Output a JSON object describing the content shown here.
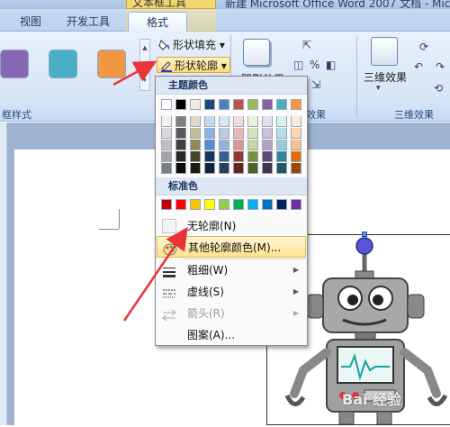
{
  "titlebar": {
    "tool_tab_text": "文本框工具",
    "window_title": "新建 Microsoft Office Word 2007 文档 - Mic"
  },
  "tabs": [
    {
      "label": "视图"
    },
    {
      "label": "开发工具"
    },
    {
      "label": "格式"
    }
  ],
  "ribbon": {
    "group_labels": {
      "box_styles": "框样式",
      "shadow_effects": "效果",
      "threeD_effects": "三维效果"
    },
    "style_swatches": [
      "#8567b4",
      "#4aaec5",
      "#f29644"
    ],
    "shape_fill_label": "形状填充",
    "shape_outline_label": "形状轮廓",
    "shadow_label": "阴影效果",
    "threeD_label": "三维效果"
  },
  "dropdown": {
    "theme_colors_header": "主题颜色",
    "standard_colors_header": "标准色",
    "theme_top_row": [
      "#ffffff",
      "#000000",
      "#eeece1",
      "#1f497d",
      "#4f81bd",
      "#c0504d",
      "#9bbb59",
      "#8064a2",
      "#4bacc6",
      "#f79646"
    ],
    "theme_shades": [
      [
        "#f2f2f2",
        "#7f7f7f",
        "#ddd9c3",
        "#c6d9f0",
        "#dbe5f1",
        "#f2dcdb",
        "#ebf1dd",
        "#e5e0ec",
        "#dbeef3",
        "#fdeada"
      ],
      [
        "#d8d8d8",
        "#595959",
        "#c4bd97",
        "#8db3e2",
        "#b8cce4",
        "#e5b9b7",
        "#d7e3bc",
        "#ccc1d9",
        "#b7dde8",
        "#fbd5b5"
      ],
      [
        "#bfbfbf",
        "#3f3f3f",
        "#938953",
        "#548dd4",
        "#95b3d7",
        "#d99694",
        "#c3d69b",
        "#b2a2c7",
        "#92cddc",
        "#fac08f"
      ],
      [
        "#a5a5a5",
        "#262626",
        "#494429",
        "#17365d",
        "#366092",
        "#953734",
        "#76923c",
        "#5f497a",
        "#31859b",
        "#e36c09"
      ],
      [
        "#7f7f7f",
        "#0c0c0c",
        "#1d1b10",
        "#0f243e",
        "#244061",
        "#632423",
        "#4f6128",
        "#3f3151",
        "#205867",
        "#974806"
      ]
    ],
    "standard_colors": [
      "#c00000",
      "#ff0000",
      "#ffc000",
      "#ffff00",
      "#92d050",
      "#00b050",
      "#00b0f0",
      "#0070c0",
      "#002060",
      "#7030a0"
    ],
    "items": {
      "no_outline": "无轮廓(N)",
      "more_colors": "其他轮廓颜色(M)...",
      "weight": "粗细(W)",
      "dashes": "虚线(S)",
      "arrows": "箭头(R)",
      "pattern": "图案(A)..."
    }
  },
  "watermark": "Bai 经验",
  "colors": {
    "accent_red_arrow": "#e8343b",
    "ribbon_bg": "#dbe7f7",
    "hover_bg": "#ffe28f"
  }
}
